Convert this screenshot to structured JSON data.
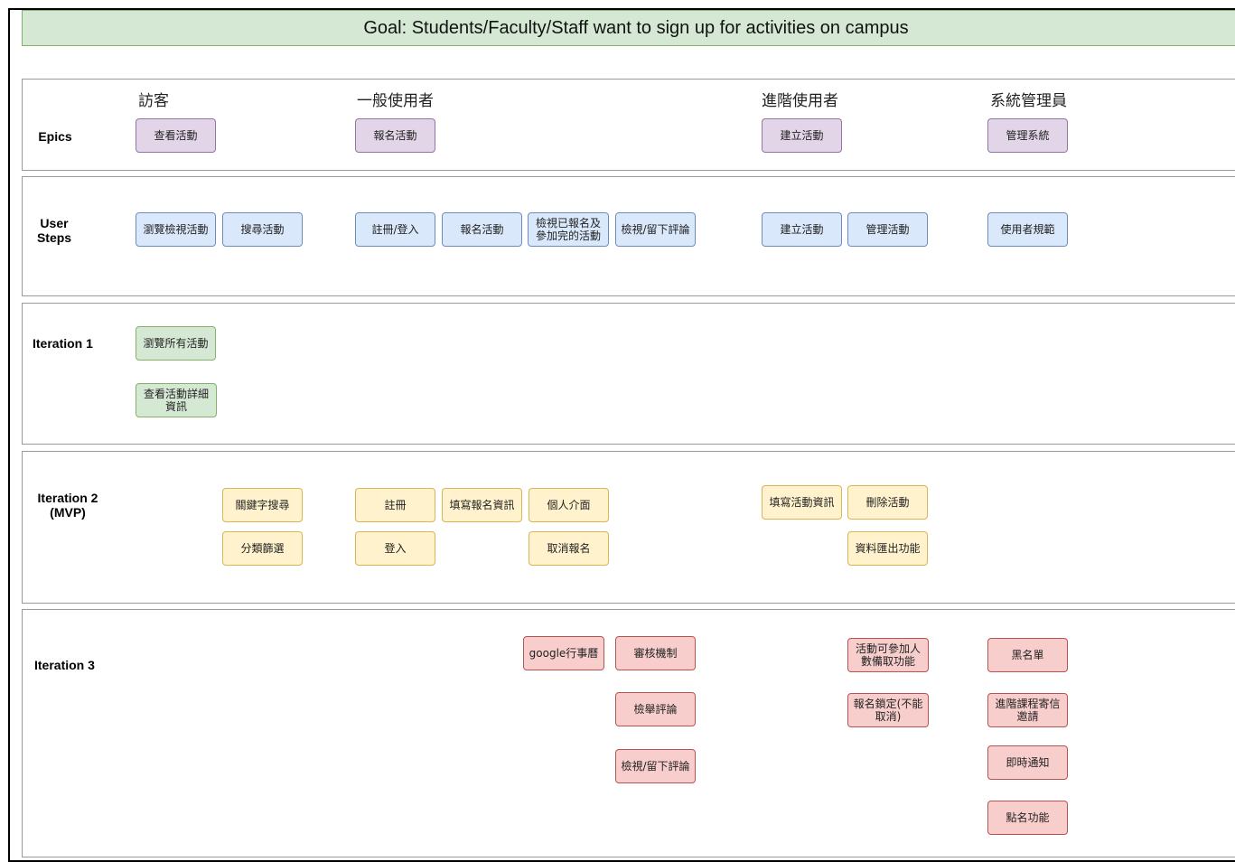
{
  "goal": "Goal: Students/Faculty/Staff want to sign up for activities on campus",
  "lanes": {
    "epics": "Epics",
    "user_steps": "User\nSteps",
    "iteration1": "Iteration 1",
    "iteration2": "Iteration 2\n(MVP)",
    "iteration3": "Iteration 3"
  },
  "personas": {
    "visitor": "訪客",
    "general_user": "一般使用者",
    "advanced_user": "進階使用者",
    "admin": "系統管理員"
  },
  "epics": {
    "view_activities": "查看活動",
    "register_activity": "報名活動",
    "create_activity": "建立活動",
    "manage_system": "管理系統"
  },
  "user_steps": {
    "browse_view": "瀏覽檢視活動",
    "search": "搜尋活動",
    "signup_login": "註冊/登入",
    "register": "報名活動",
    "view_registered": "檢視已報名及\n參加完的活動",
    "view_leave_review": "檢視/留下評論",
    "create": "建立活動",
    "manage": "管理活動",
    "user_rules": "使用者規範"
  },
  "iteration1": {
    "browse_all": "瀏覽所有活動",
    "view_details": "查看活動詳細\n資訊"
  },
  "iteration2": {
    "keyword_search": "關鍵字搜尋",
    "category_filter": "分類篩選",
    "signup": "註冊",
    "login": "登入",
    "fill_registration": "填寫報名資訊",
    "personal_page": "個人介面",
    "cancel_registration": "取消報名",
    "fill_activity_info": "填寫活動資訊",
    "delete_activity": "刪除活動",
    "data_export": "資料匯出功能"
  },
  "iteration3": {
    "google_calendar": "google行事曆",
    "review_mechanism": "審核機制",
    "report_review": "檢舉評論",
    "view_leave_review": "檢視/留下評論",
    "waitlist": "活動可參加人\n數備取功能",
    "registration_lock": "報名鎖定(不能\n取消)",
    "blacklist": "黑名單",
    "advanced_invite": "進階課程寄信\n邀請",
    "instant_notify": "即時通知",
    "attendance": "點名功能"
  },
  "colors": {
    "goal_bg": "#d5e8d4",
    "epic": "#e1d5e7",
    "user_step": "#dae8fc",
    "iteration1": "#d5e8d4",
    "iteration2": "#fff2cc",
    "iteration3": "#f8cecc"
  }
}
